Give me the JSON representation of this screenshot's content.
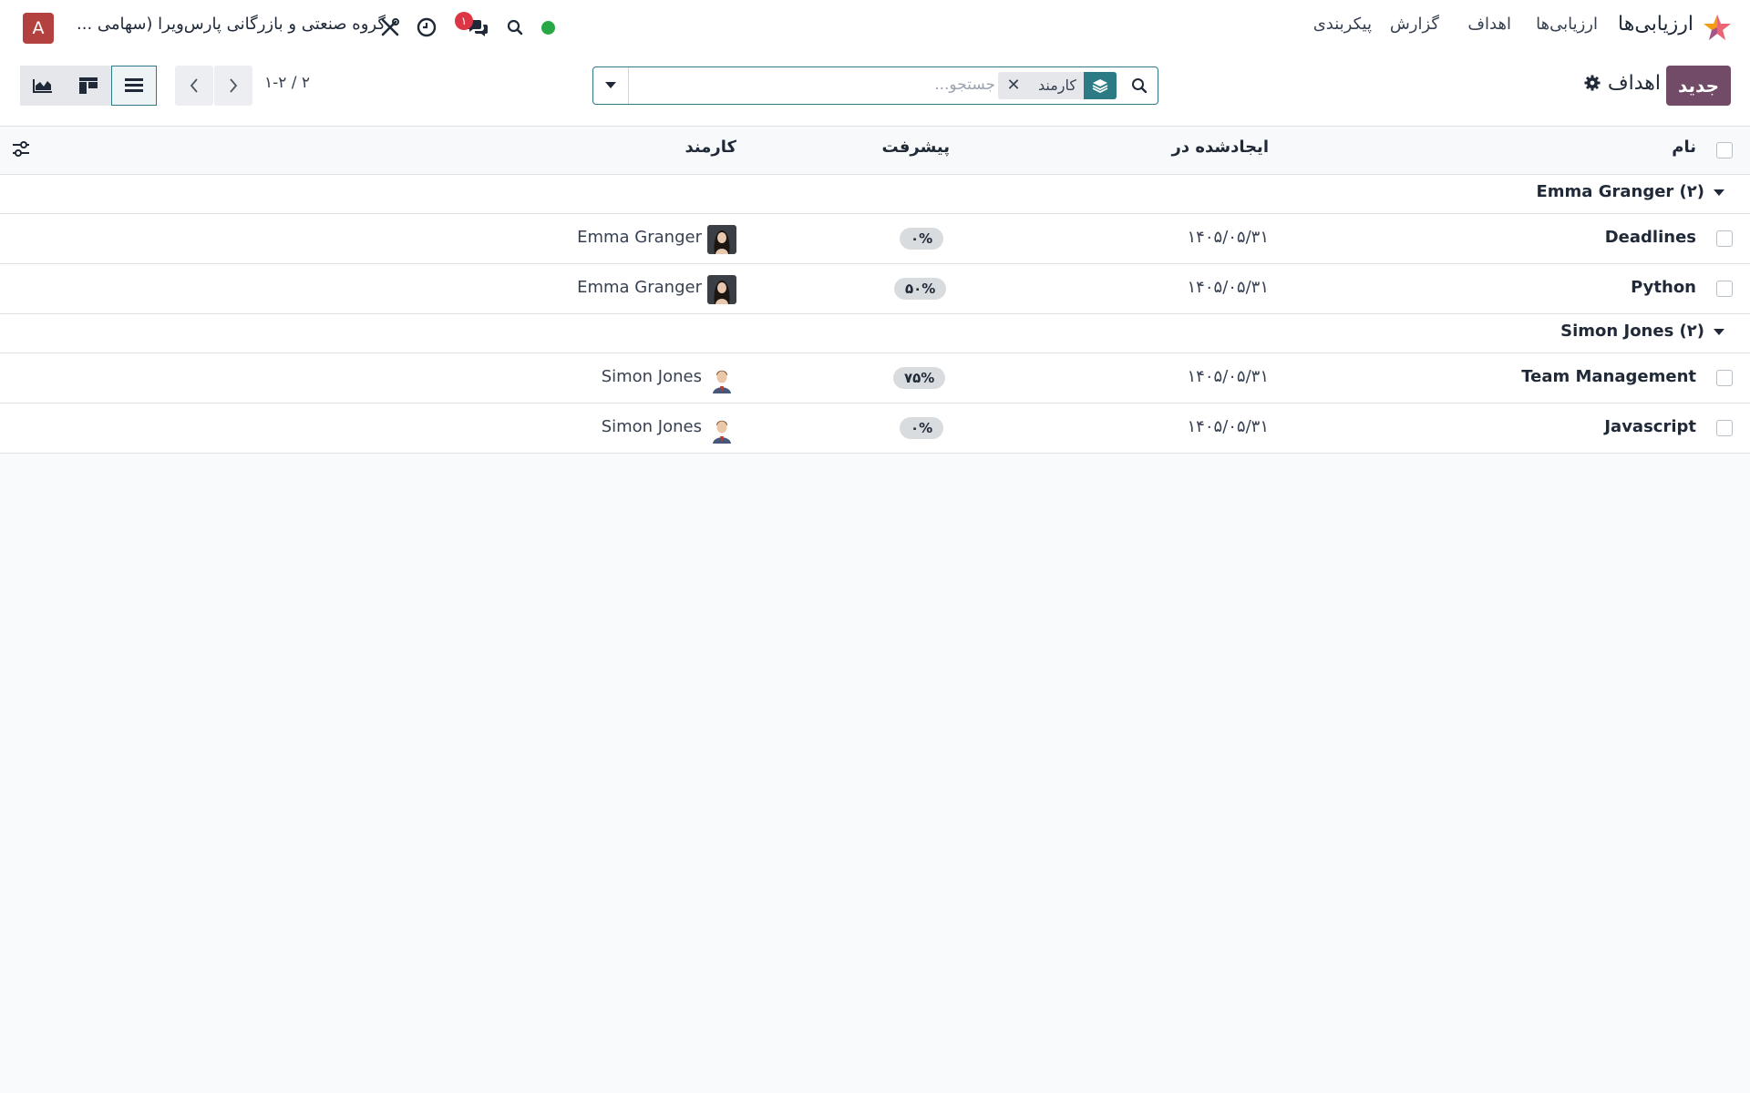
{
  "topbar": {
    "app_title": "ارزیابی‌ها",
    "menu": {
      "appraisals": "ارزیابی‌ها",
      "goals": "اهداف",
      "reporting": "گزارش",
      "configuration": "پیکربندی"
    },
    "company": "گروه صنعتی و بازرگانی پارس‌ویرا (سهامی ...",
    "user_initial": "A",
    "messages_count": "۱",
    "status_color": "#28a745"
  },
  "control": {
    "new_button": "جدید",
    "breadcrumb": "اهداف",
    "search": {
      "placeholder": "جستجو...",
      "facet_label": "کارمند"
    },
    "pager": "۱-۲ / ۲"
  },
  "table": {
    "columns": {
      "name": "نام",
      "created_on": "ایجادشده در",
      "progress": "پیشرفت",
      "employee": "کارمند"
    },
    "groups": [
      {
        "label": "Emma Granger (۲)",
        "rows": [
          {
            "name": "Deadlines",
            "date": "۱۴۰۵/۰۵/۳۱",
            "progress": "۰%",
            "employee": "Emma Granger"
          },
          {
            "name": "Python",
            "date": "۱۴۰۵/۰۵/۳۱",
            "progress": "۵۰%",
            "employee": "Emma Granger"
          }
        ]
      },
      {
        "label": "Simon Jones (۲)",
        "rows": [
          {
            "name": "Team Management",
            "date": "۱۴۰۵/۰۵/۳۱",
            "progress": "۷۵%",
            "employee": "Simon Jones"
          },
          {
            "name": "Javascript",
            "date": "۱۴۰۵/۰۵/۳۱",
            "progress": "۰%",
            "employee": "Simon Jones"
          }
        ]
      }
    ]
  },
  "colors": {
    "brand": "#714b67",
    "accent": "#2e7a86",
    "danger": "#dc3545"
  }
}
